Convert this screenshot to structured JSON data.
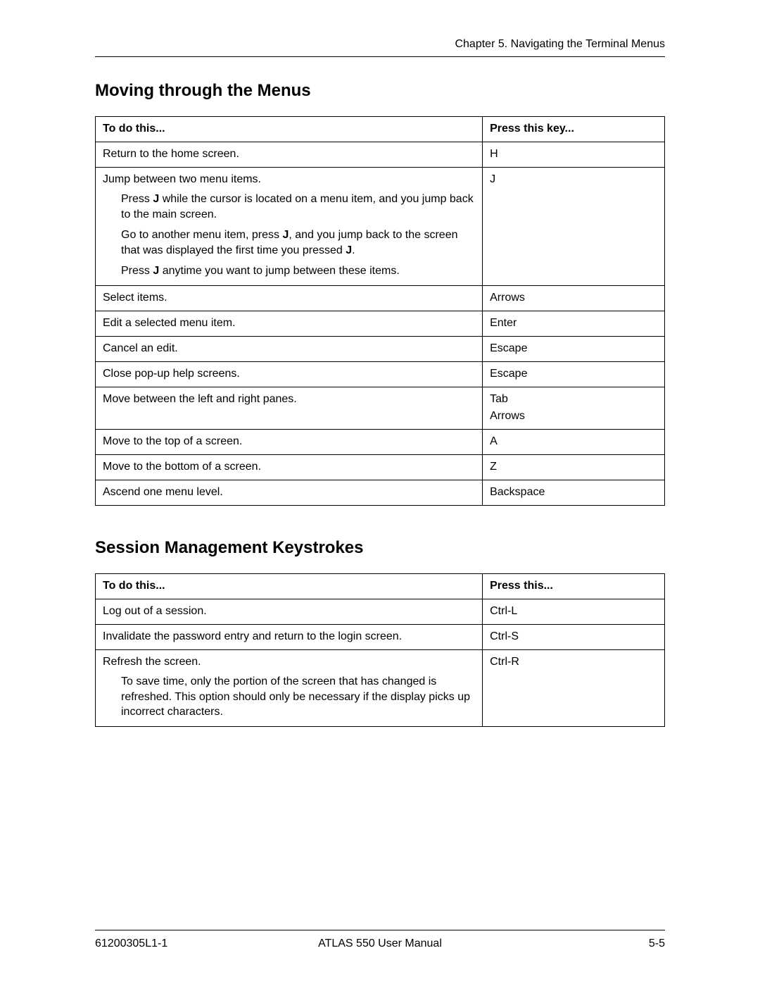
{
  "header": {
    "chapter_line": "Chapter 5.  Navigating the Terminal Menus"
  },
  "section1": {
    "title": "Moving through the Menus",
    "col1": "To do this...",
    "col2": "Press this key...",
    "rows": {
      "r0": {
        "action": "Return to the home screen.",
        "key": "H"
      },
      "r1": {
        "action": "Jump between two menu items.",
        "note1_a": "Press ",
        "note1_b": "J",
        "note1_c": " while the cursor is located on a menu item, and you jump back to the main screen.",
        "note2_a": "Go to another menu item, press ",
        "note2_b": "J",
        "note2_c": ", and you jump back to the screen that was displayed the first time you pressed ",
        "note2_d": "J",
        "note2_e": ".",
        "note3_a": "Press ",
        "note3_b": "J",
        "note3_c": " anytime you want to jump between these items.",
        "key": "J"
      },
      "r2": {
        "action": "Select items.",
        "key": "Arrows"
      },
      "r3": {
        "action": "Edit a selected menu item.",
        "key": "Enter"
      },
      "r4": {
        "action": "Cancel an edit.",
        "key": "Escape"
      },
      "r5": {
        "action": "Close pop-up help screens.",
        "key": "Escape"
      },
      "r6": {
        "action": "Move between the left and right panes.",
        "key1": "Tab",
        "key2": "Arrows"
      },
      "r7": {
        "action": "Move to the top of a screen.",
        "key": "A"
      },
      "r8": {
        "action": "Move to the bottom of a screen.",
        "key": "Z"
      },
      "r9": {
        "action": "Ascend one menu level.",
        "key": "Backspace"
      }
    }
  },
  "section2": {
    "title": "Session Management Keystrokes",
    "col1": "To do this...",
    "col2": "Press this...",
    "rows": {
      "r0": {
        "action": "Log out of a session.",
        "key": "Ctrl-L"
      },
      "r1": {
        "action": "Invalidate the password entry and return to the login screen.",
        "key": "Ctrl-S"
      },
      "r2": {
        "action": "Refresh the screen.",
        "note": "To save time, only the portion of the screen that has changed is refreshed. This option should only be necessary if the display picks up incorrect characters.",
        "key": "Ctrl-R"
      }
    }
  },
  "footer": {
    "left": "61200305L1-1",
    "center": "ATLAS 550 User Manual",
    "right": "5-5"
  }
}
